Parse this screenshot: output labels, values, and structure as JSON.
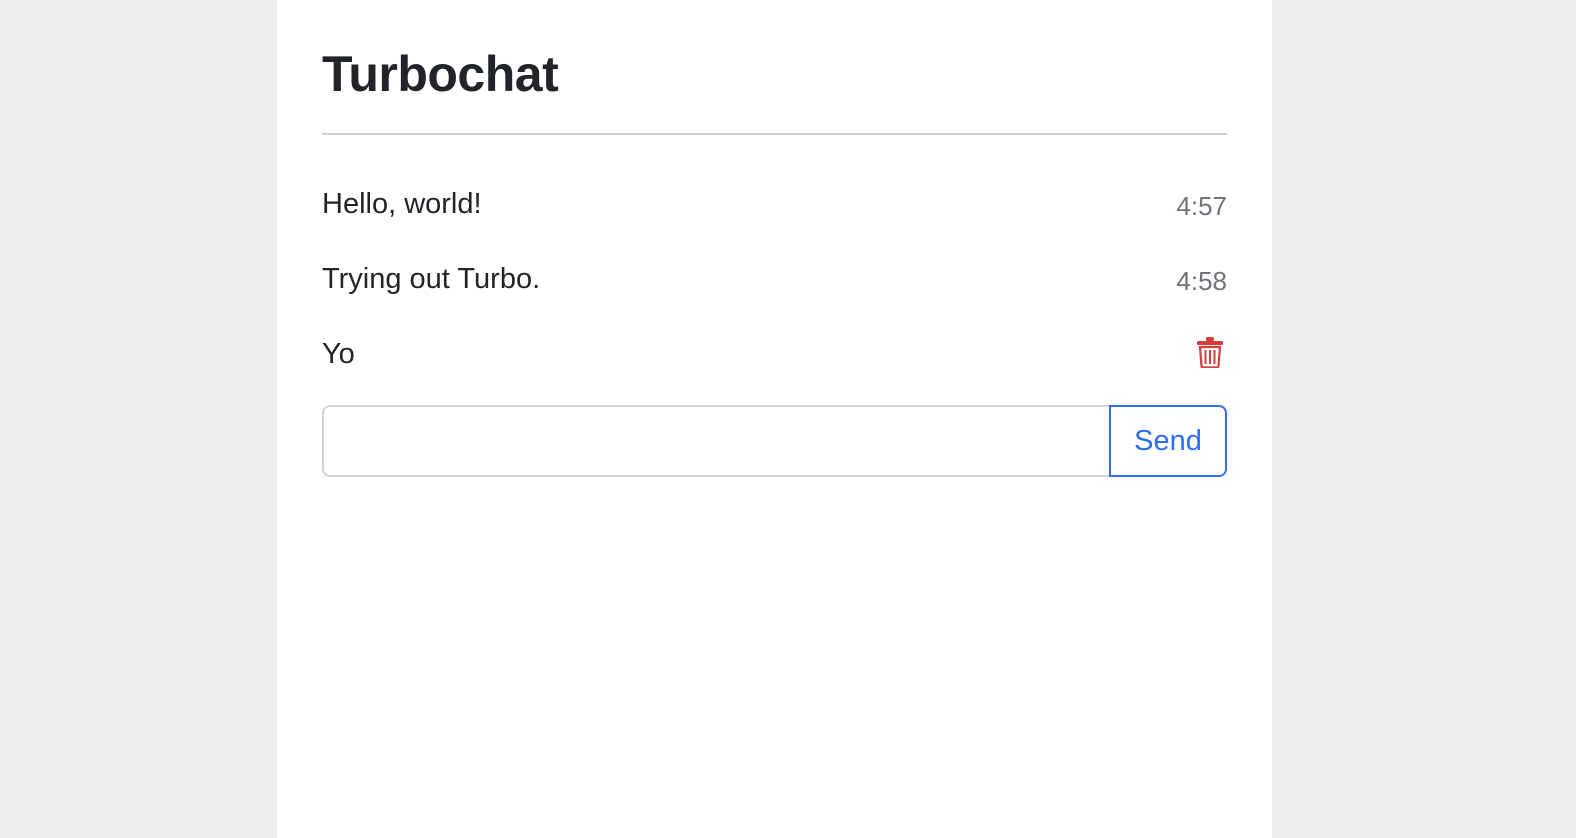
{
  "app": {
    "title": "Turbochat"
  },
  "messages": [
    {
      "text": "Hello, world!",
      "time": "4:57"
    },
    {
      "text": "Trying out Turbo.",
      "time": "4:58"
    },
    {
      "text": "Yo",
      "action_icon": "trash-icon"
    }
  ],
  "composer": {
    "input_value": "",
    "send_label": "Send"
  },
  "colors": {
    "page_background": "#ededed",
    "card_background": "#ffffff",
    "accent": "#2f6df2",
    "danger": "#d63c3c",
    "muted_text": "#6c757d"
  }
}
